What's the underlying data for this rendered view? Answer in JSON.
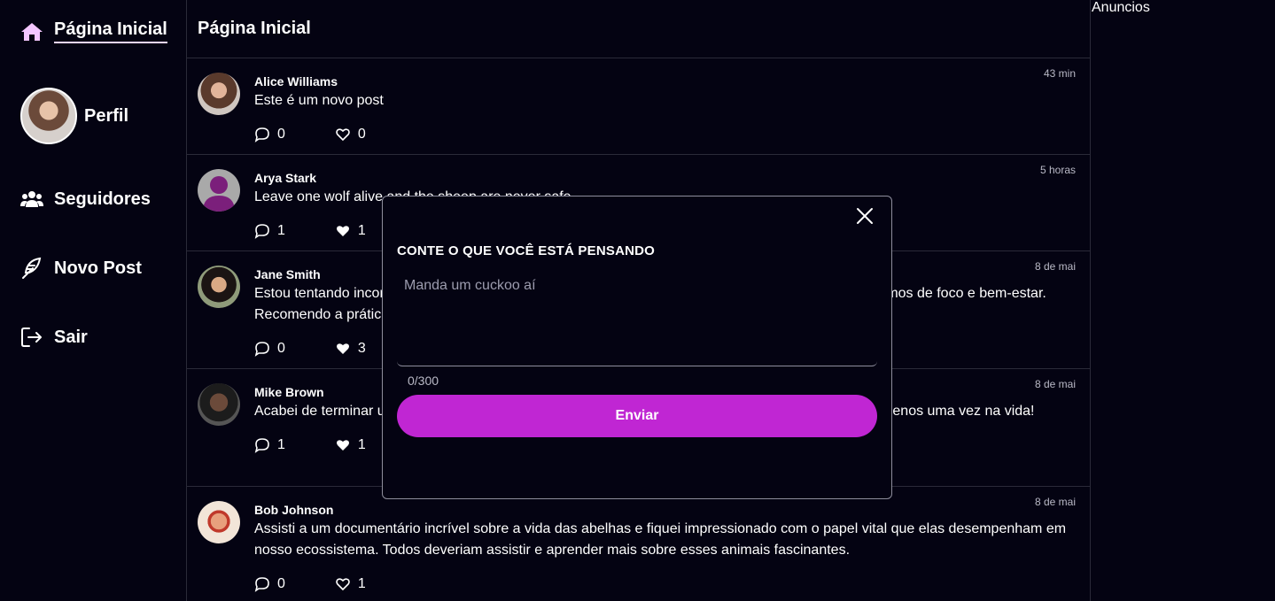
{
  "sidebar": {
    "items": [
      {
        "label": "Página Inicial",
        "icon": "home-icon"
      },
      {
        "label": "Perfil",
        "icon": "avatar"
      },
      {
        "label": "Seguidores",
        "icon": "users-icon"
      },
      {
        "label": "Novo Post",
        "icon": "feather-icon"
      },
      {
        "label": "Sair",
        "icon": "logout-icon"
      }
    ]
  },
  "main": {
    "title": "Página Inicial",
    "posts": [
      {
        "author": "Alice Williams",
        "text": "Este é um novo post",
        "time": "43 min",
        "comments": "0",
        "likes": "0",
        "liked": false
      },
      {
        "author": "Arya Stark",
        "text": "Leave one wolf alive and the sheep are never safe",
        "time": "5 horas",
        "comments": "1",
        "likes": "1",
        "liked": true
      },
      {
        "author": "Jane Smith",
        "text": "Estou tentando incorporar a meditação na minha rotina diária e já notei uma grande diferença em termos de foco e bem-estar. Recomendo a prática a todos!",
        "time": "8 de mai",
        "comments": "0",
        "likes": "3",
        "liked": true
      },
      {
        "author": "Mike Brown",
        "text": "Acabei de terminar uma sessão de yoga incrível. Acho que todos deveriam experimentar yoga pelo menos uma vez na vida!",
        "time": "8 de mai",
        "comments": "1",
        "likes": "1",
        "liked": true
      },
      {
        "author": "Bob Johnson",
        "text": "Assisti a um documentário incrível sobre a vida das abelhas e fiquei impressionado com o papel vital que elas desempenham em nosso ecossistema. Todos deveriam assistir e aprender mais sobre esses animais fascinantes.",
        "time": "8 de mai",
        "comments": "0",
        "likes": "1",
        "liked": false
      }
    ]
  },
  "ads": {
    "title": "Anuncios"
  },
  "modal": {
    "title": "CONTE O QUE VOCÊ ESTÁ PENSANDO",
    "placeholder": "Manda um cuckoo aí",
    "counter": "0/300",
    "send_label": "Enviar"
  },
  "colors": {
    "background": "#040312",
    "accent": "#c026d3",
    "home_icon": "#f3c6ff"
  }
}
